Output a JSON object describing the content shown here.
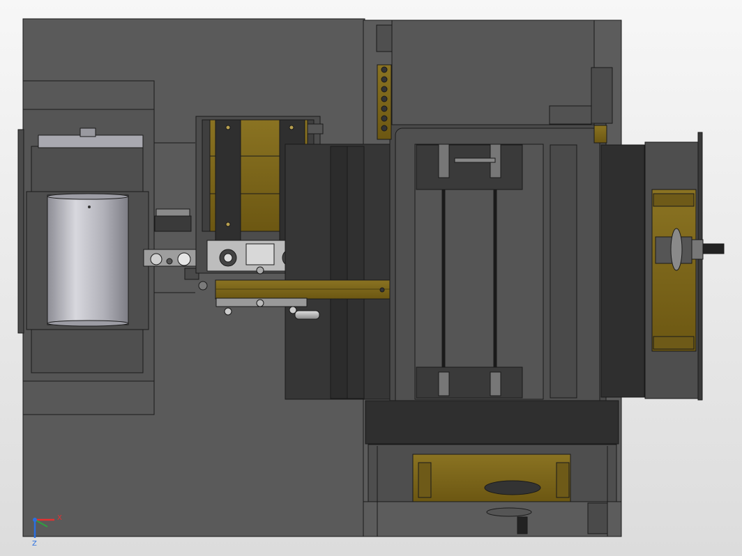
{
  "view": {
    "background_top": "#f7f7f7",
    "background_bottom": "#dcdcdc"
  },
  "colors": {
    "base_plate": "#5a5a5a",
    "dark_part": "#3c3c3c",
    "darker_part": "#2b2b2b",
    "brass": "#7a6418",
    "brass_light": "#8f7a2a",
    "cylinder": "#b5b5bc",
    "silver": "#c8c8c8",
    "edge_line": "#1a1a1a",
    "axis_x": "#e53030",
    "axis_y": "#2a6fe0",
    "axis_z": "#2a6fe0"
  },
  "triad": {
    "x_label": "X",
    "z_label": "Z"
  },
  "icons": {
    "triad": "coordinate-triad-icon"
  }
}
